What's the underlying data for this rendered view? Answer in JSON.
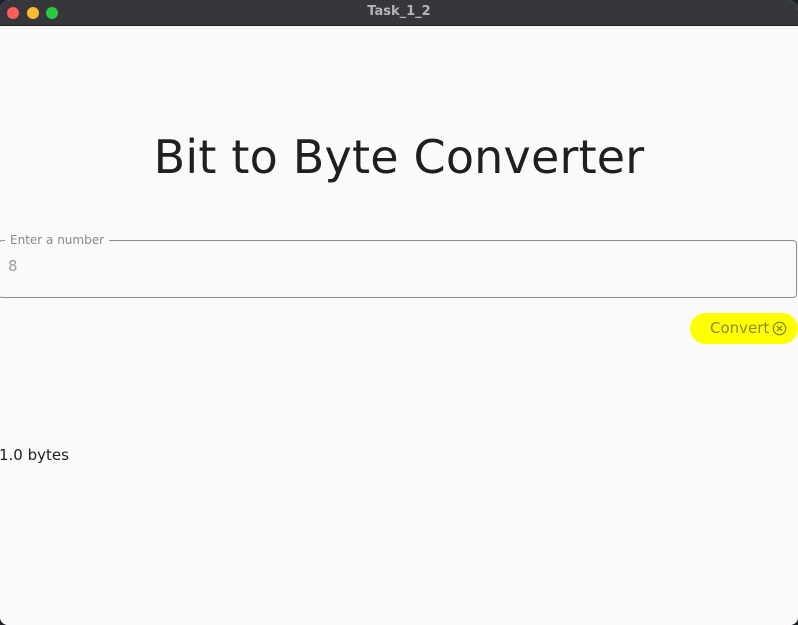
{
  "window": {
    "title": "Task_1_2"
  },
  "main": {
    "heading": "Bit to Byte Converter",
    "input": {
      "label": "Enter a number",
      "value": "8",
      "placeholder": ""
    },
    "convert_button": {
      "label": "Convert",
      "icon": "cancel-circle-icon",
      "background_color": "#ffff00"
    },
    "result": "1.0 bytes"
  }
}
